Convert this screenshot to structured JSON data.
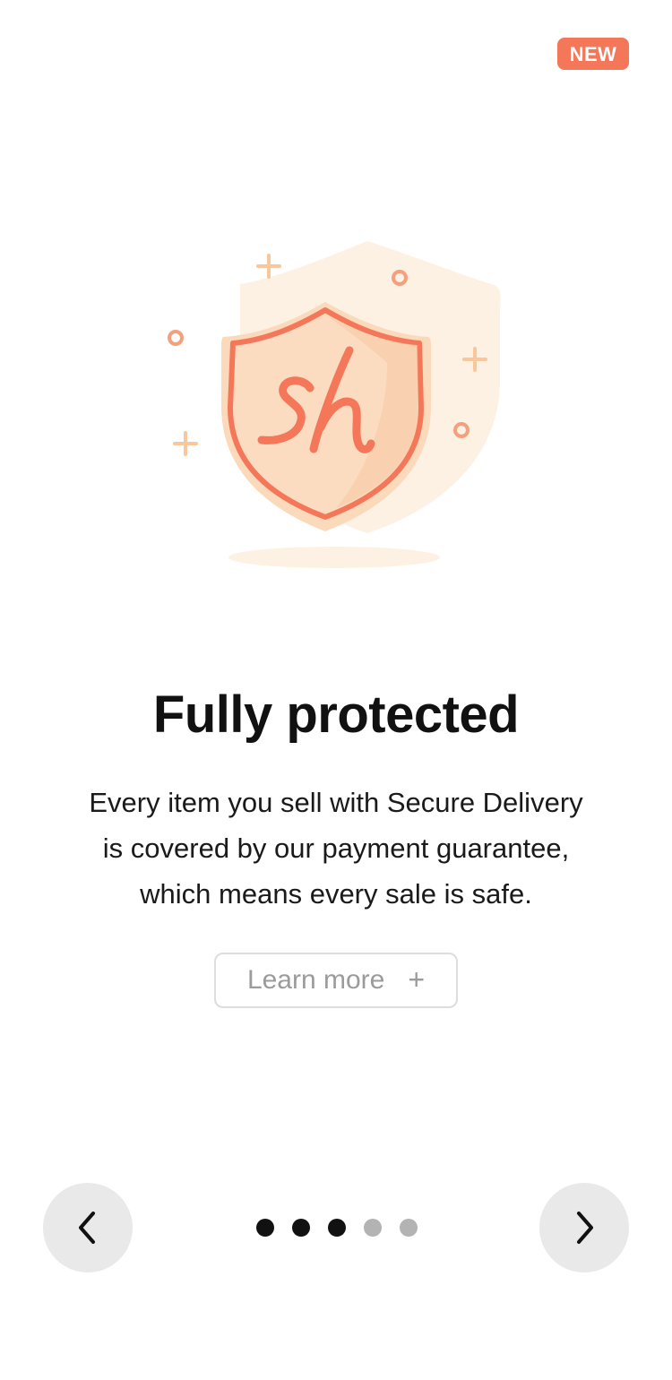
{
  "badge": {
    "label": "NEW"
  },
  "illustration": {
    "logo_text": "sh",
    "icon": "shield-icon",
    "colors": {
      "accent": "#f4775a",
      "shield_fill": "#fcd9bd",
      "shield_back": "#fdf1e4",
      "sparkle": "#f8c79c"
    }
  },
  "content": {
    "title": "Fully protected",
    "description_lines": [
      "Every item you sell with Secure Delivery",
      "is covered by our payment guarantee,",
      "which means every sale is safe."
    ],
    "learn_more_label": "Learn more",
    "learn_more_icon": "+"
  },
  "navigation": {
    "prev_icon": "chevron-left-icon",
    "next_icon": "chevron-right-icon",
    "total_pages": 5,
    "current_page": 3
  }
}
